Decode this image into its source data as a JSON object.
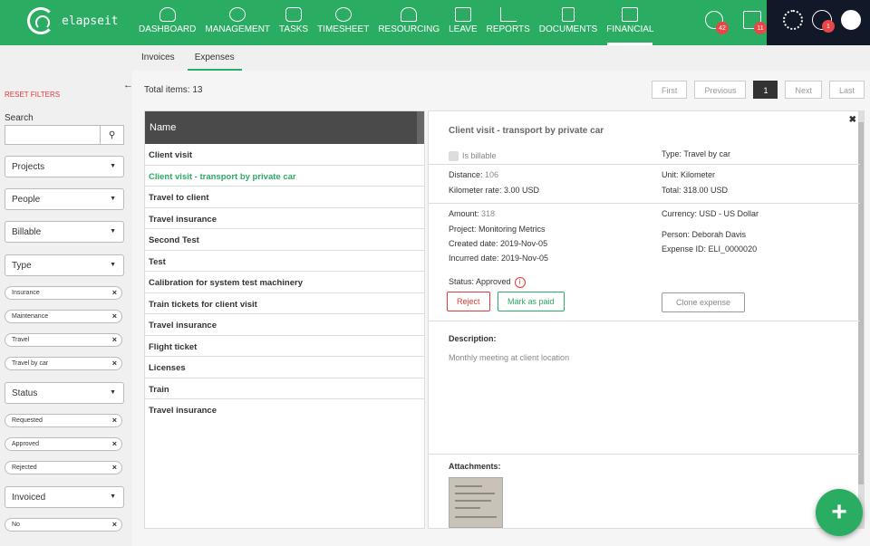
{
  "brand": {
    "name": "elapseit"
  },
  "nav": [
    {
      "label": "DASHBOARD",
      "icon": "speedometer-icon"
    },
    {
      "label": "MANAGEMENT",
      "icon": "globe-icon"
    },
    {
      "label": "TASKS",
      "icon": "checklist-icon"
    },
    {
      "label": "TIMESHEET",
      "icon": "stopwatch-icon"
    },
    {
      "label": "RESOURCING",
      "icon": "people-icon"
    },
    {
      "label": "LEAVE",
      "icon": "calendar-icon"
    },
    {
      "label": "REPORTS",
      "icon": "chart-icon"
    },
    {
      "label": "DOCUMENTS",
      "icon": "document-icon"
    },
    {
      "label": "FINANCIAL",
      "icon": "wallet-icon"
    }
  ],
  "top_icons": {
    "timer_badge": "42",
    "calendar_badge": "11",
    "help_badge": "1"
  },
  "subtabs": [
    "Invoices",
    "Expenses"
  ],
  "sidebar": {
    "reset": "RESET FILTERS",
    "search_label": "Search",
    "search_placeholder": "",
    "filters": {
      "projects": "Projects",
      "people": "People",
      "billable": "Billable",
      "type": "Type",
      "status": "Status",
      "invoiced": "Invoiced"
    },
    "type_chips": [
      "Insurance",
      "Maintenance",
      "Travel",
      "Travel by car"
    ],
    "status_chips": [
      "Requested",
      "Approved",
      "Rejected"
    ],
    "invoiced_chips": [
      "No"
    ]
  },
  "main": {
    "total": "Total items: 13",
    "pager": {
      "first": "First",
      "previous": "Previous",
      "current": "1",
      "next": "Next",
      "last": "Last"
    },
    "list_header": "Name",
    "rows": [
      "Client visit",
      "Client visit - transport by private car",
      "Travel to client",
      "Travel insurance",
      "Second Test",
      "Test",
      "Calibration for system test machinery",
      "Train tickets for client visit",
      "Travel insurance",
      "Flight ticket",
      "Licenses",
      "Train",
      "Travel insurance"
    ]
  },
  "detail": {
    "title": "Client visit - transport by private car",
    "is_billable": "Is billable",
    "type": "Type: Travel by car",
    "distance_label": "Distance:",
    "distance": "106",
    "unit": "Unit: Kilometer",
    "rate": "Kilometer rate: 3.00 USD",
    "total": "Total: 318.00 USD",
    "amount_label": "Amount:",
    "amount": "318",
    "currency": "Currency: USD - US Dollar",
    "project": "Project: Monitoring Metrics",
    "person": "Person:  Deborah Davis",
    "created": "Created date: 2019-Nov-05",
    "expense_id": "Expense ID: ELI_0000020",
    "incurred": "Incurred date: 2019-Nov-05",
    "status": "Status: Approved",
    "reject": "Reject",
    "mark_paid": "Mark as paid",
    "clone": "Clone expense",
    "description_label": "Description:",
    "description": "Monthly meeting at client location",
    "attachments_label": "Attachments:"
  },
  "fab": "+",
  "colors": {
    "brand": "#2bac63",
    "danger": "#e53935"
  }
}
